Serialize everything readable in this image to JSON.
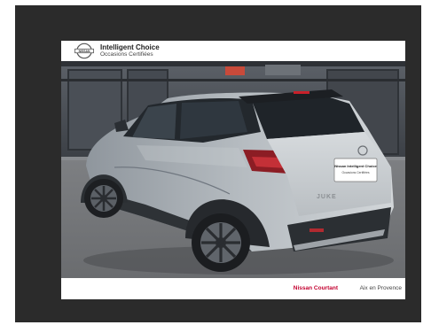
{
  "header": {
    "title": "Intelligent Choice",
    "subtitle": "Occasions Certifiées",
    "logo_text": "NISSAN",
    "logo_icon": "nissan-logo-icon"
  },
  "photo": {
    "subject": "car-rear-three-quarter",
    "plate_line1": "Nissan Intelligent Choice",
    "plate_line2": "Occasions Certifiées",
    "badge": "JUKE"
  },
  "footer": {
    "dealer": "Nissan Courtant",
    "city": "Aix en Provence"
  },
  "colors": {
    "frame": "#2b2b2b",
    "accent": "#c3002f",
    "card": "#ffffff"
  }
}
